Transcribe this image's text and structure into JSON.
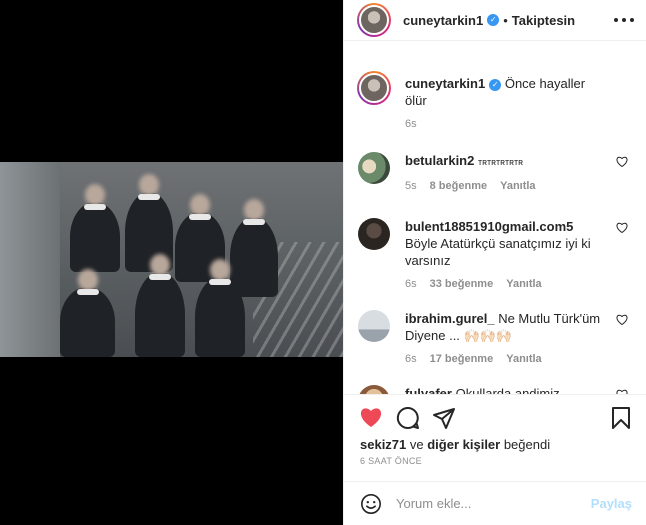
{
  "post": {
    "author": "cuneytarkin1",
    "follow_separator": "•",
    "follow_status": "Takiptesin",
    "caption": "Önce hayaller ölür",
    "caption_time": "6s"
  },
  "comments": [
    {
      "username": "betularkin2",
      "text": "ᴛʀᴛʀᴛʀᴛʀᴛʀ",
      "time": "5s",
      "likes": "8 beğenme",
      "reply": "Yanıtla"
    },
    {
      "username": "bulent18851910gmail.com5",
      "text": "Böyle Atatürkçü sanatçımız iyi ki varsınız",
      "time": "6s",
      "likes": "33 beğenme",
      "reply": "Yanıtla"
    },
    {
      "username": "ibrahim.gurel_",
      "text": "Ne Mutlu Türk'üm Diyene ... 🙌🏻🙌🏻🙌🏻",
      "time": "6s",
      "likes": "17 beğenme",
      "reply": "Yanıtla"
    },
    {
      "username": "fulyafer",
      "text": "Okullarda andimiz"
    }
  ],
  "likes_line": {
    "user": "sekiz71",
    "mid": " ve ",
    "others": "diğer kişiler",
    "end": " beğendi"
  },
  "time_ago": "6 SAAT ÖNCE",
  "comment_box": {
    "placeholder": "Yorum ekle...",
    "post_label": "Paylaş"
  },
  "colors": {
    "like_red": "#ed4956",
    "post_disabled": "#b2dffc",
    "verified_blue": "#3897f0"
  },
  "icons": [
    "heart-icon",
    "comment-icon",
    "share-icon",
    "bookmark-icon",
    "more-options-icon",
    "emoji-icon",
    "verified-icon"
  ]
}
